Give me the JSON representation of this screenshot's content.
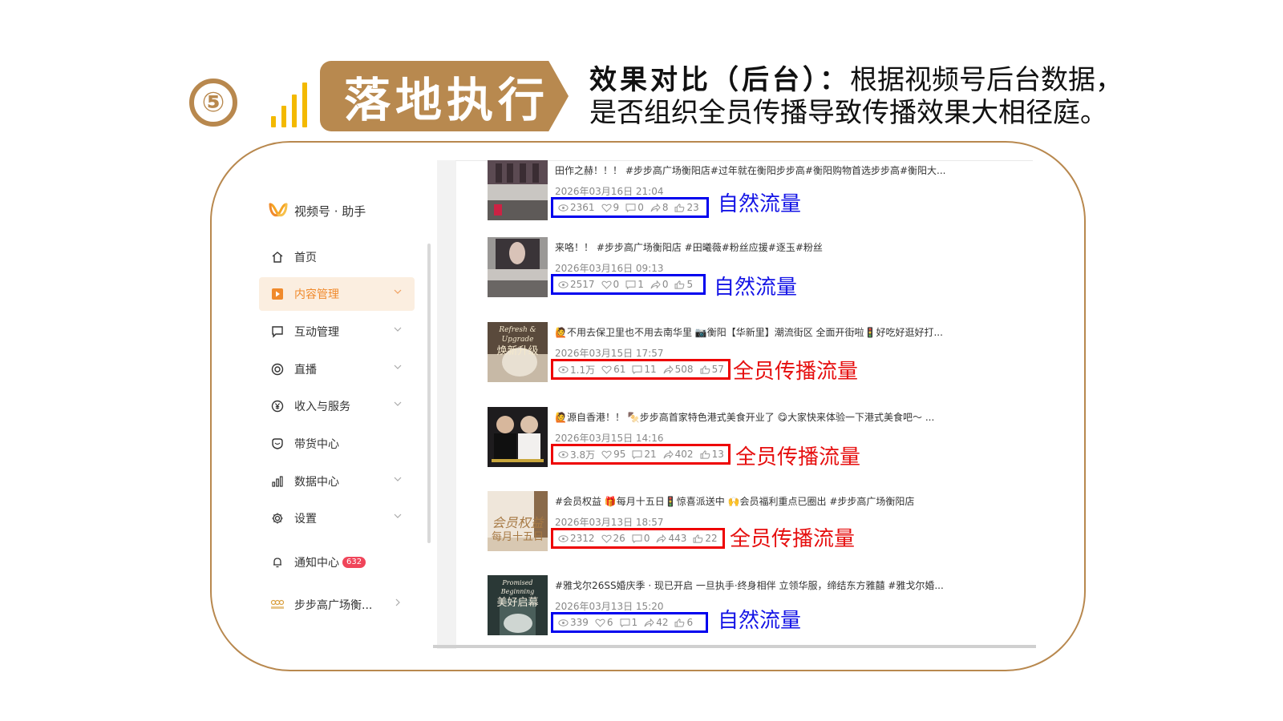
{
  "header": {
    "step_number": "⑤",
    "banner_title": "落地执行",
    "desc_bold": "效果对比（后台）：",
    "desc_line1_rest": "根据视频号后台数据，",
    "desc_line2": "是否组织全员传播导致传播效果大相径庭。"
  },
  "colors": {
    "brand_gold": "#b8884e",
    "signal_yellow": "#f3b900",
    "natural_blue": "#0000ee",
    "staff_red": "#ee0000",
    "active_orange": "#f08a2c"
  },
  "sidebar": {
    "logo_icon": "channels-logo-icon",
    "logo_text": "视频号 · 助手",
    "items": [
      {
        "label": "首页",
        "icon": "home-icon"
      },
      {
        "label": "内容管理",
        "icon": "content-icon",
        "active": true
      },
      {
        "label": "互动管理",
        "icon": "comment-icon"
      },
      {
        "label": "直播",
        "icon": "live-icon"
      },
      {
        "label": "收入与服务",
        "icon": "yuan-icon"
      },
      {
        "label": "带货中心",
        "icon": "shop-icon"
      },
      {
        "label": "数据中心",
        "icon": "chart-icon"
      },
      {
        "label": "设置",
        "icon": "gear-icon"
      }
    ],
    "notify_label": "通知中心",
    "notify_badge": "632",
    "account_label": "步步高广场衡..."
  },
  "videos": [
    {
      "title": "田作之赫！！！ #步步高广场衡阳店#过年就在衡阳步步高#衡阳购物首选步步高#衡阳大...",
      "date": "2026年03月16日 21:04",
      "views": "2361",
      "likes": "9",
      "comments": "0",
      "shares": "8",
      "thumbs": "23",
      "tag": "自然流量",
      "kind": "blue"
    },
    {
      "title": "来咯！！ #步步高广场衡阳店 #田曦薇#粉丝应援#逐玉#粉丝",
      "date": "2026年03月16日 09:13",
      "views": "2517",
      "likes": "0",
      "comments": "1",
      "shares": "0",
      "thumbs": "5",
      "tag": "自然流量",
      "kind": "blue"
    },
    {
      "title": "🙋不用去保卫里也不用去南华里 📷衡阳【华新里】潮流街区 全面开街啦🚦好吃好逛好打...",
      "date": "2026年03月15日 17:57",
      "views": "1.1万",
      "likes": "61",
      "comments": "11",
      "shares": "508",
      "thumbs": "57",
      "tag": "全员传播流量",
      "kind": "red"
    },
    {
      "title": "🙋源自香港！！ 🍢步步高首家特色港式美食开业了 😋大家快来体验一下港式美食吧～ ...",
      "date": "2026年03月15日 14:16",
      "views": "3.8万",
      "likes": "95",
      "comments": "21",
      "shares": "402",
      "thumbs": "13",
      "tag": "全员传播流量",
      "kind": "red"
    },
    {
      "title": "#会员权益 🎁每月十五日🚦惊喜派送中 🙌会员福利重点已圈出 #步步高广场衡阳店",
      "date": "2026年03月13日 18:57",
      "views": "2312",
      "likes": "26",
      "comments": "0",
      "shares": "443",
      "thumbs": "22",
      "tag": "全员传播流量",
      "kind": "red"
    },
    {
      "title": "#雅戈尔26SS婚庆季 · 现已开启 一旦执手·终身相伴 立领华服，缔结东方雅囍 #雅戈尔婚...",
      "date": "2026年03月13日 15:20",
      "views": "339",
      "likes": "6",
      "comments": "1",
      "shares": "42",
      "thumbs": "6",
      "tag": "自然流量",
      "kind": "blue"
    }
  ],
  "thumb_texts": {
    "t3_line1": "Refresh & Upgrade",
    "t3_line2": "焕新升级",
    "t5_line1": "会员权益",
    "t5_line2": "每月十五日",
    "t6_line1": "Promised Beginning",
    "t6_line2": "美好启幕"
  }
}
